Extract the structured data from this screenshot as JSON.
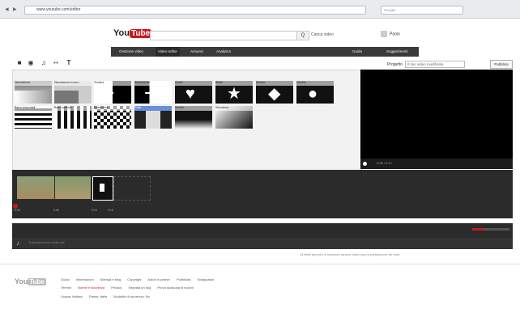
{
  "browser": {
    "url_text": "www.youtube.com/editor",
    "search_placeholder": "Google"
  },
  "header": {
    "logo_you": "You",
    "logo_tube": "Tube",
    "search_button": "Q",
    "upload_label": "Carica video",
    "user_name": "Paolo"
  },
  "nav": {
    "tabs": [
      {
        "label": "Gestione video"
      },
      {
        "label": "Video editor"
      },
      {
        "label": "Annunci"
      },
      {
        "label": "Analytics"
      }
    ],
    "right_links": [
      {
        "label": "Guida"
      },
      {
        "label": "Suggerimenti"
      }
    ]
  },
  "toolbar": {
    "icons": [
      "video-icon",
      "camera-icon",
      "music-icon",
      "transitions-icon",
      "text-icon"
    ],
    "project_label": "Progetto",
    "project_value": "Il mio video modificato",
    "publish_label": "Pubblica"
  },
  "transitions": [
    {
      "label": "Dissolvenza"
    },
    {
      "label": "Dissolvenza in nero"
    },
    {
      "label": "Tendina"
    },
    {
      "label": "Scorrimento"
    },
    {
      "label": "Cuore"
    },
    {
      "label": "Stella"
    },
    {
      "label": "Rombo"
    },
    {
      "label": "Cerchio"
    },
    {
      "label": "Barre orizzontali"
    },
    {
      "label": "Barre verticali"
    },
    {
      "label": "Scacchiera"
    },
    {
      "label": "Porte"
    },
    {
      "label": "Nuvole"
    },
    {
      "label": "Sfumatura"
    }
  ],
  "preview": {
    "time": "0:00 / 0:17"
  },
  "timeline": {
    "ticks": [
      "0:00",
      "0:05",
      "0:10",
      "0:15"
    ]
  },
  "audio": {
    "placeholder": "Trascina tracce audio qui"
  },
  "note": "Gli effetti speciali e le transizioni saranno visibili dopo la pubblicazione del video.",
  "footer": {
    "row1": [
      "Guida",
      "Informazioni",
      "Stampa e blog",
      "Copyright",
      "Autori e partner",
      "Pubblicità",
      "Sviluppatori"
    ],
    "row2": [
      "Termini",
      "Norme e sicurezza",
      "Privacy",
      "Segnala un bug",
      "Prova qualcosa di nuovo!"
    ],
    "row3": [
      "Lingua: Italiano",
      "Paese: Italia",
      "Modalità di sicurezza: No"
    ]
  },
  "colors": {
    "accent": "#cc181e",
    "nav": "#3a3a3a",
    "timeline": "#2b2b2b"
  }
}
